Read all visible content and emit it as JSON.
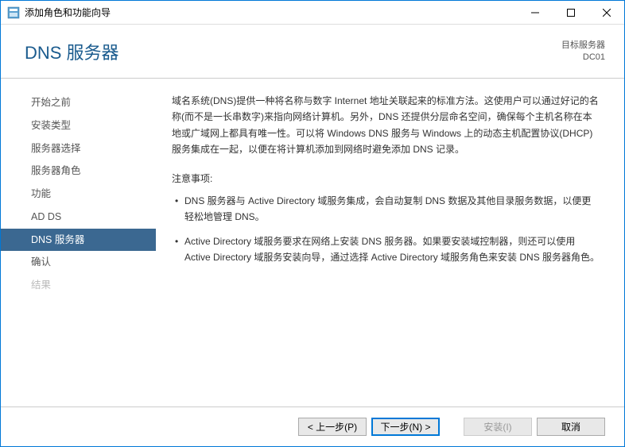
{
  "titlebar": {
    "title": "添加角色和功能向导"
  },
  "header": {
    "page_title": "DNS 服务器",
    "target_label": "目标服务器",
    "target_name": "DC01"
  },
  "sidebar": {
    "items": [
      {
        "label": "开始之前"
      },
      {
        "label": "安装类型"
      },
      {
        "label": "服务器选择"
      },
      {
        "label": "服务器角色"
      },
      {
        "label": "功能"
      },
      {
        "label": "AD DS"
      },
      {
        "label": "DNS 服务器"
      },
      {
        "label": "确认"
      },
      {
        "label": "结果"
      }
    ]
  },
  "main": {
    "description": "域名系统(DNS)提供一种将名称与数字 Internet 地址关联起来的标准方法。这使用户可以通过好记的名称(而不是一长串数字)来指向网络计算机。另外，DNS 还提供分层命名空间，确保每个主机名称在本地或广域网上都具有唯一性。可以将 Windows DNS 服务与 Windows 上的动态主机配置协议(DHCP)服务集成在一起，以便在将计算机添加到网络时避免添加 DNS 记录。",
    "notes_label": "注意事项:",
    "notes": [
      "DNS 服务器与 Active Directory 域服务集成，会自动复制 DNS 数据及其他目录服务数据，以便更轻松地管理 DNS。",
      "Active Directory 域服务要求在网络上安装 DNS 服务器。如果要安装域控制器，则还可以使用 Active Directory 域服务安装向导，通过选择 Active Directory 域服务角色来安装 DNS 服务器角色。"
    ]
  },
  "footer": {
    "prev": "< 上一步(P)",
    "next": "下一步(N) >",
    "install": "安装(I)",
    "cancel": "取消"
  }
}
